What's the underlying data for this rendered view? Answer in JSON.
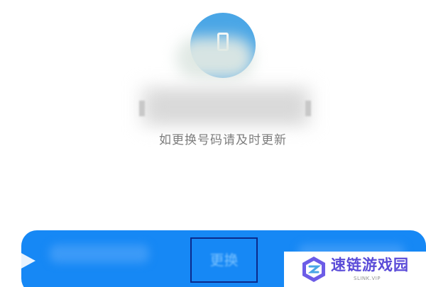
{
  "hint_text": "如更换号码请及时更新",
  "button": {
    "label": "更换"
  },
  "watermark": {
    "title": "速链游戏园",
    "subtitle": "SLINK.VIP"
  },
  "icons": {
    "phone": "phone-icon",
    "arrow": "arrow-icon",
    "logo": "watermark-logo-icon"
  },
  "colors": {
    "primary_blue": "#1688f5",
    "icon_blue": "#4aa6e6",
    "hint_gray": "#7d7d7d",
    "highlight_border": "#0a2a8c",
    "watermark_purple": "#5a4bd8"
  }
}
